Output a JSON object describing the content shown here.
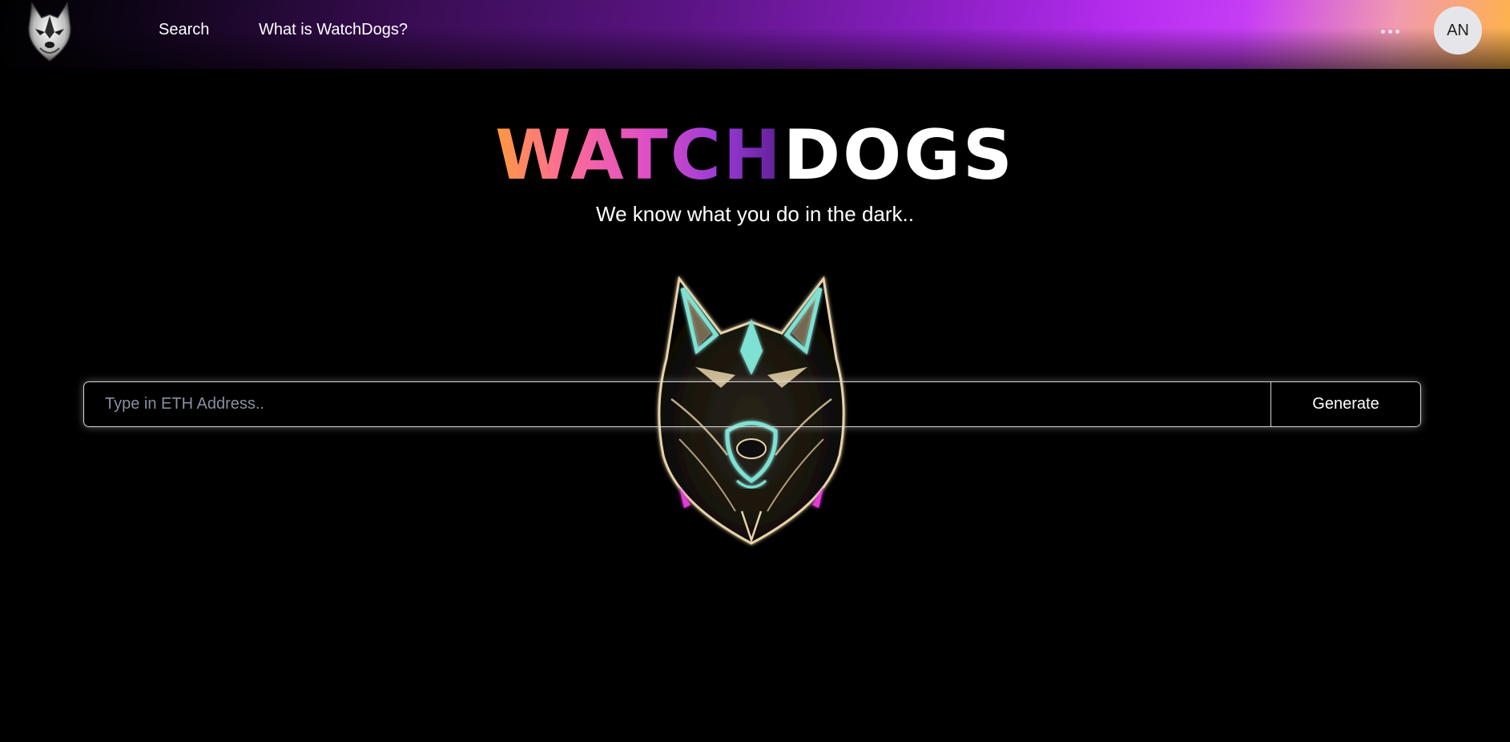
{
  "nav": {
    "logo_icon": "husky-logo-icon",
    "links": [
      {
        "label": "Search"
      },
      {
        "label": "What is WatchDogs?"
      }
    ],
    "more_icon": "more-horizontal-icon",
    "avatar_initials": "AN"
  },
  "hero": {
    "title_part1": "WATCH",
    "title_part2": "DOGS",
    "tagline": "We know what you do in the dark..",
    "illustration_icon": "neon-wolf-head-icon"
  },
  "search": {
    "placeholder": "Type in ETH Address..",
    "value": "",
    "button_label": "Generate"
  },
  "colors": {
    "background": "#000000",
    "nav_gradient": [
      "#000000",
      "#3a0d55",
      "#b62df0",
      "#ffb347"
    ],
    "title_gradient": [
      "#ff9a3d",
      "#ff6f91",
      "#e04fc6",
      "#9a3bd6",
      "#5d1d93"
    ],
    "wolf_glow": "#7fe0d4",
    "wolf_fur": "#e8d3a8"
  }
}
